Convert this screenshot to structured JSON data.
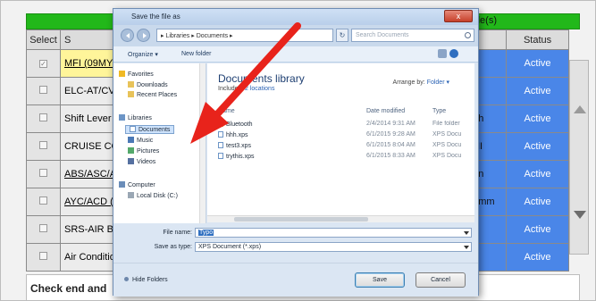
{
  "background_app": {
    "header_right": "le(s)",
    "columns": {
      "select": "Select",
      "name": "S",
      "status": "Status"
    },
    "rows": [
      {
        "name": "MFI (09MY)",
        "extra": "",
        "status": "Active"
      },
      {
        "name": "ELC-AT/CV",
        "extra": "",
        "status": "Active"
      },
      {
        "name": "Shift Lever",
        "extra": "gh",
        "status": "Active"
      },
      {
        "name": "CRUISE CO",
        "extra": "HI",
        "status": "Active"
      },
      {
        "name": "ABS/ASC/A",
        "extra": "on",
        "status": "Active"
      },
      {
        "name": "AYC/ACD (A",
        "extra": "omm",
        "status": "Active"
      },
      {
        "name": "SRS-AIR BA",
        "extra": "",
        "status": "Active"
      },
      {
        "name": "Air Condition",
        "extra": "",
        "status": "Active"
      }
    ],
    "footer": "Check end and"
  },
  "dialog": {
    "title": "Save the file as",
    "close_label": "x",
    "address": "▸ Libraries ▸ Documents ▸",
    "search_placeholder": "Search Documents",
    "toolbar": {
      "organize": "Organize ▾",
      "new_folder": "New folder"
    },
    "nav": {
      "favorites": "Favorites",
      "downloads": "Downloads",
      "recent": "Recent Places",
      "libraries": "Libraries",
      "documents": "Documents",
      "music": "Music",
      "pictures": "Pictures",
      "videos": "Videos",
      "computer": "Computer",
      "local_disk": "Local Disk (C:)"
    },
    "library": {
      "title": "Documents library",
      "includes_prefix": "Includes:",
      "includes_link": "2 locations",
      "arrange_prefix": "Arrange by:",
      "arrange_value": "Folder ▾"
    },
    "columns": {
      "name": "Name",
      "date": "Date modified",
      "type": "Type"
    },
    "files": [
      {
        "name": "Bluetooth",
        "date": "2/4/2014 9:31 AM",
        "type": "File folder",
        "kind": "folder"
      },
      {
        "name": "hhh.xps",
        "date": "6/1/2015 9:28 AM",
        "type": "XPS Docu",
        "kind": "xps"
      },
      {
        "name": "test3.xps",
        "date": "6/1/2015 8:04 AM",
        "type": "XPS Docu",
        "kind": "xps"
      },
      {
        "name": "trythis.xps",
        "date": "6/1/2015 8:33 AM",
        "type": "XPS Docu",
        "kind": "xps"
      }
    ],
    "file_name_label": "File name:",
    "file_name_value": "Typo",
    "save_type_label": "Save as type:",
    "save_type_value": "XPS Document (*.xps)",
    "hide_folders": "Hide Folders",
    "save_label": "Save",
    "cancel_label": "Cancel"
  },
  "colors": {
    "green_header": "#22b81a",
    "status_blue": "#4a86e8",
    "selected_row": "#fff59a",
    "arrow_red": "#e8231b"
  }
}
